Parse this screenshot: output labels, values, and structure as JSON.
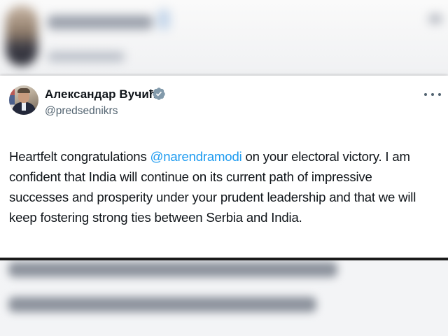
{
  "tweet": {
    "author": {
      "display_name": "Александар Вучић",
      "handle": "@predsednikrs",
      "verified_icon": "verified-badge-icon",
      "avatar_icon": "profile-photo"
    },
    "text": {
      "line1_before": "Heartfelt congratulations ",
      "mention": "@narendramodi",
      "line1_after": " on your electoral victory. I am",
      "line2": "confident that India will continue on its current path of impressive",
      "line3": "successes and prosperity under your prudent leadership and that we will",
      "line4": "keep fostering strong ties between Serbia and India."
    },
    "more_icon": "more-options-icon"
  },
  "colors": {
    "text": "#0f1419",
    "secondary": "#536471",
    "mention": "#1d9bf0",
    "verified_badge": "#829aab"
  }
}
